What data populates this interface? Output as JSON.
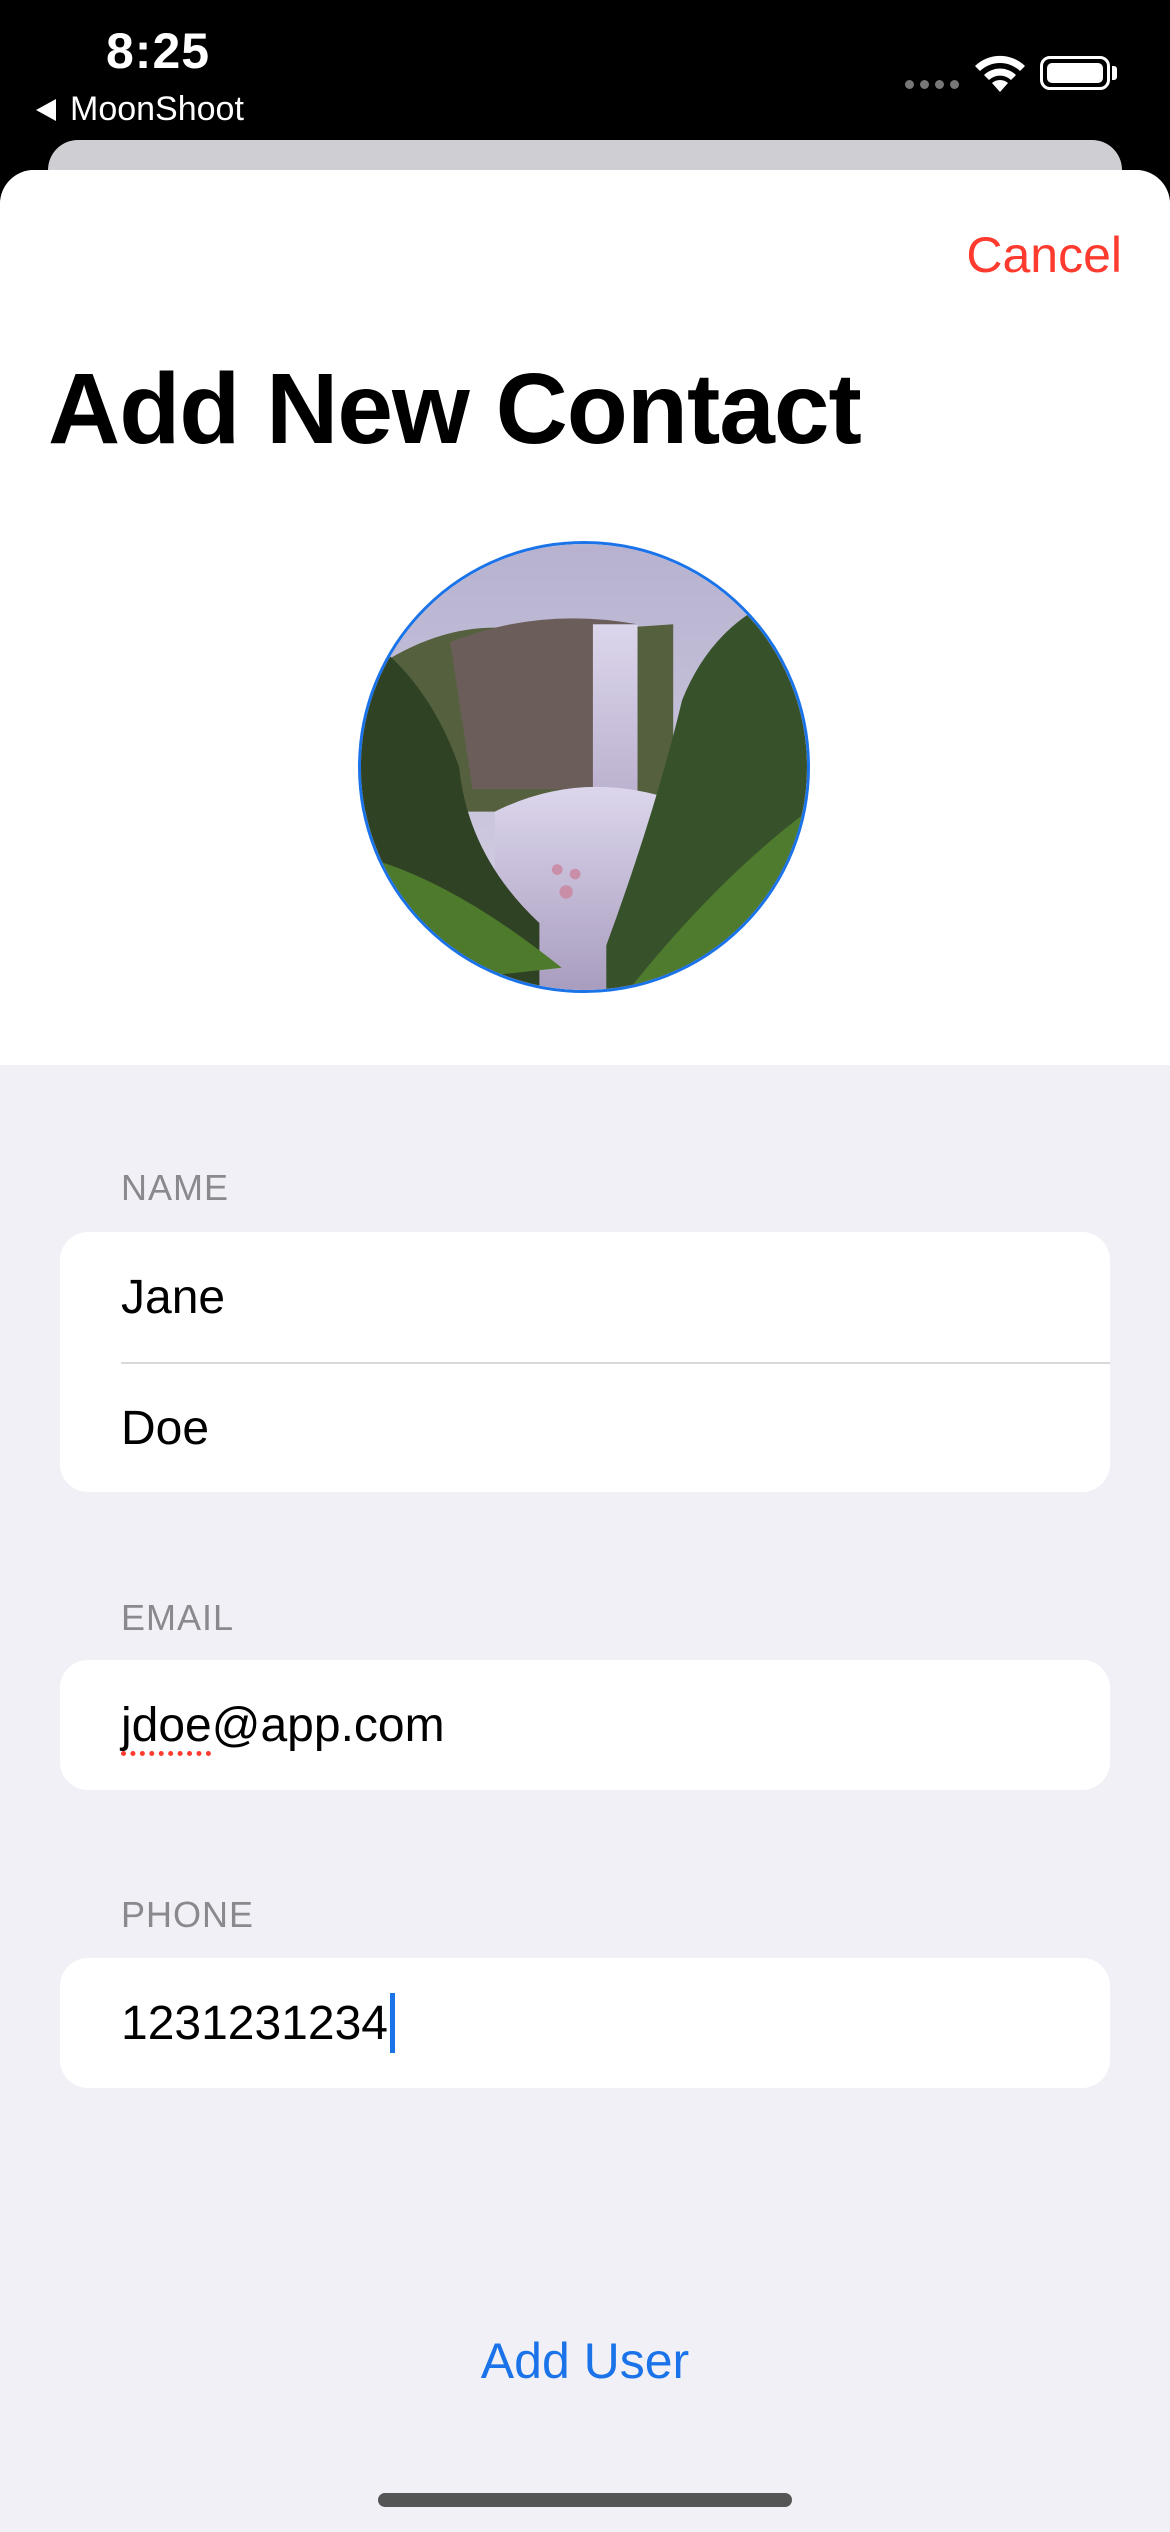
{
  "status_bar": {
    "time": "8:25",
    "back_label": "MoonShoot",
    "icons": [
      "signal-dots-icon",
      "wifi-icon",
      "battery-icon"
    ]
  },
  "sheet": {
    "cancel_label": "Cancel",
    "title": "Add New Contact",
    "avatar": {
      "icon": "waterfall-photo"
    }
  },
  "form": {
    "name": {
      "label": "NAME",
      "first_name": "Jane",
      "last_name": "Doe"
    },
    "email": {
      "label": "EMAIL",
      "value_prefix": "jdoe",
      "value_suffix": "@app.com"
    },
    "phone": {
      "label": "PHONE",
      "value": "1231231234"
    }
  },
  "actions": {
    "add_user_label": "Add User"
  },
  "colors": {
    "accent": "#1a73e8",
    "destructive": "#ff3b30",
    "grouped_background": "#f1f0f6"
  }
}
